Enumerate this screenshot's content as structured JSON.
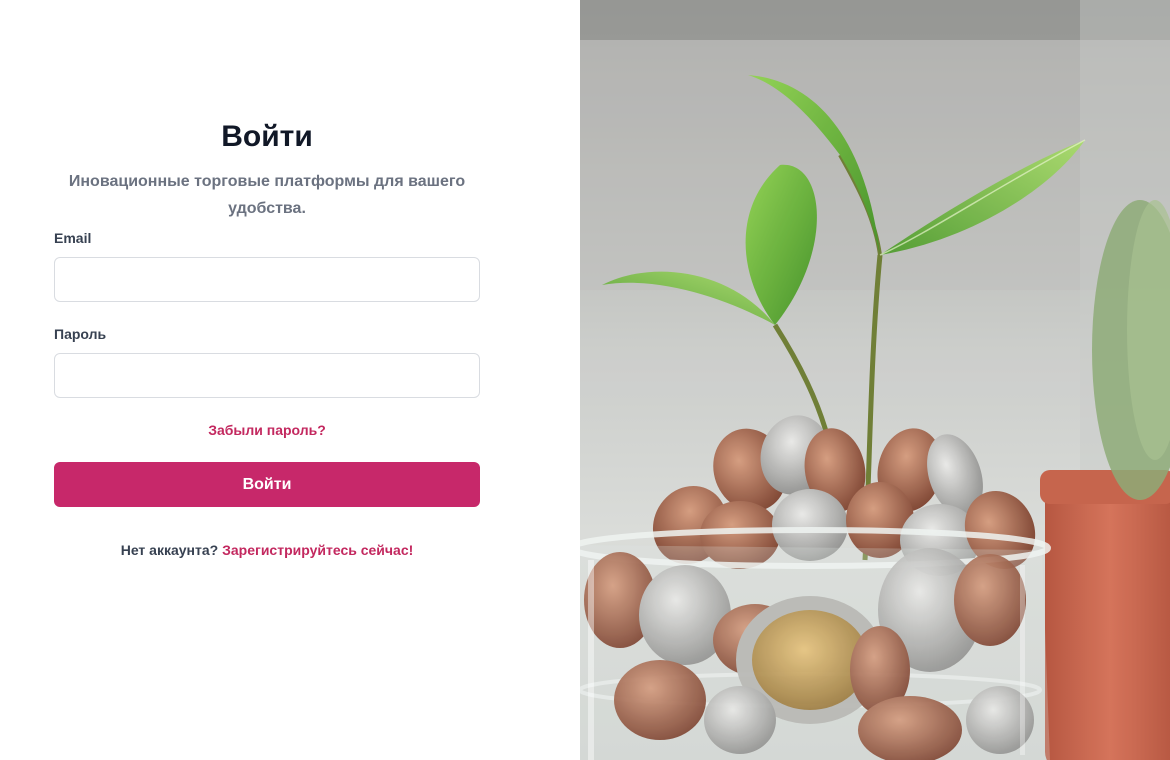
{
  "login": {
    "title": "Войти",
    "subtitle": "Иновационные торговые платформы для вашего удобства.",
    "email_label": "Email",
    "password_label": "Пароль",
    "forgot_link": "Забыли пароль?",
    "submit_label": "Войти",
    "no_account_text": "Нет аккаунта?",
    "register_link": "Зарегистрируйтесь сейчас!"
  },
  "colors": {
    "accent": "#c7286a",
    "link": "#c3285f",
    "title": "#111827",
    "subtitle": "#6b7280"
  },
  "hero_image": {
    "icon": "plant-in-coins-jar-photo"
  }
}
